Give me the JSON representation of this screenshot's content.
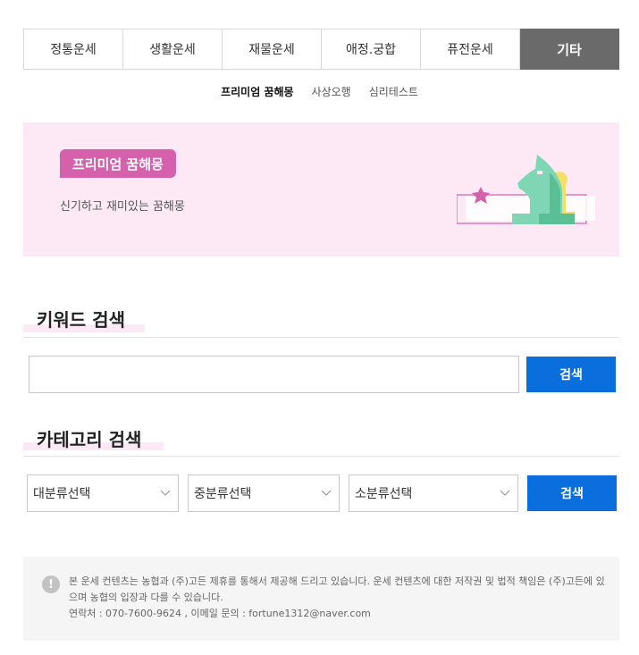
{
  "tabs": [
    {
      "label": "정통운세"
    },
    {
      "label": "생활운세"
    },
    {
      "label": "재물운세"
    },
    {
      "label": "애정.궁합"
    },
    {
      "label": "퓨전운세"
    },
    {
      "label": "기타",
      "active": true
    }
  ],
  "subtabs": [
    {
      "label": "프리미엄 꿈해몽",
      "active": true
    },
    {
      "label": "사상오행"
    },
    {
      "label": "심리테스트"
    }
  ],
  "banner": {
    "badge": "프리미엄 꿈해몽",
    "description": "신기하고 재미있는 꿈해몽",
    "icon": "chess-knight-icon",
    "colors": {
      "bg": "#fde9f6",
      "badge": "#d561ad"
    }
  },
  "keyword_section": {
    "title": "키워드 검색",
    "input_value": "",
    "button_label": "검색"
  },
  "category_section": {
    "title": "카테고리 검색",
    "selects": [
      "대분류선택",
      "중분류선택",
      "소분류선택"
    ],
    "button_label": "검색"
  },
  "notice": {
    "icon": "exclamation-icon",
    "line1": "본 운세 컨텐츠는 농협과 (주)고든 제휴를 통해서 제공해 드리고 있습니다. 운세 컨텐츠에 대한 저작권 및 법적 책임은 (주)고든에 있으며 농협의 입장과 다를 수 있습니다.",
    "line2": "연락처 : 070-7600-9624 , 이메일 문의 : fortune1312@naver.com"
  },
  "colors": {
    "accent": "#0a6fdc",
    "active_tab": "#6a6a6a"
  }
}
